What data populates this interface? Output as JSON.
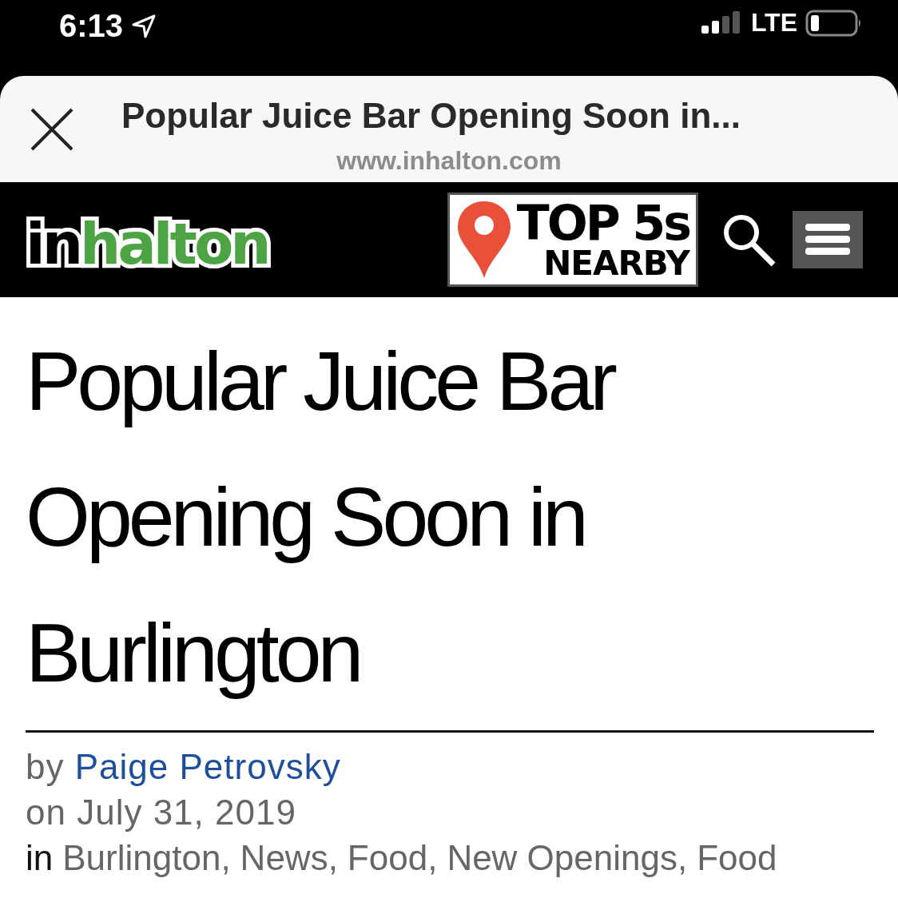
{
  "status_bar": {
    "time": "6:13",
    "network": "LTE"
  },
  "browser_sheet": {
    "title": "Popular Juice Bar Opening Soon in...",
    "url": "www.inhalton.com"
  },
  "site_header": {
    "logo_prefix": "in",
    "logo_suffix": "halton",
    "promo_line_1": "TOP 5s",
    "promo_line_2": "NEARBY"
  },
  "article": {
    "headline": "Popular Juice Bar Opening Soon in Burlington",
    "byline_prefix": "by",
    "author": "Paige Petrovsky",
    "date": "on July 31, 2019",
    "categories_prefix": "in",
    "categories": [
      "Burlington,",
      "News,",
      "Food,",
      "New Openings,",
      "Food"
    ]
  }
}
